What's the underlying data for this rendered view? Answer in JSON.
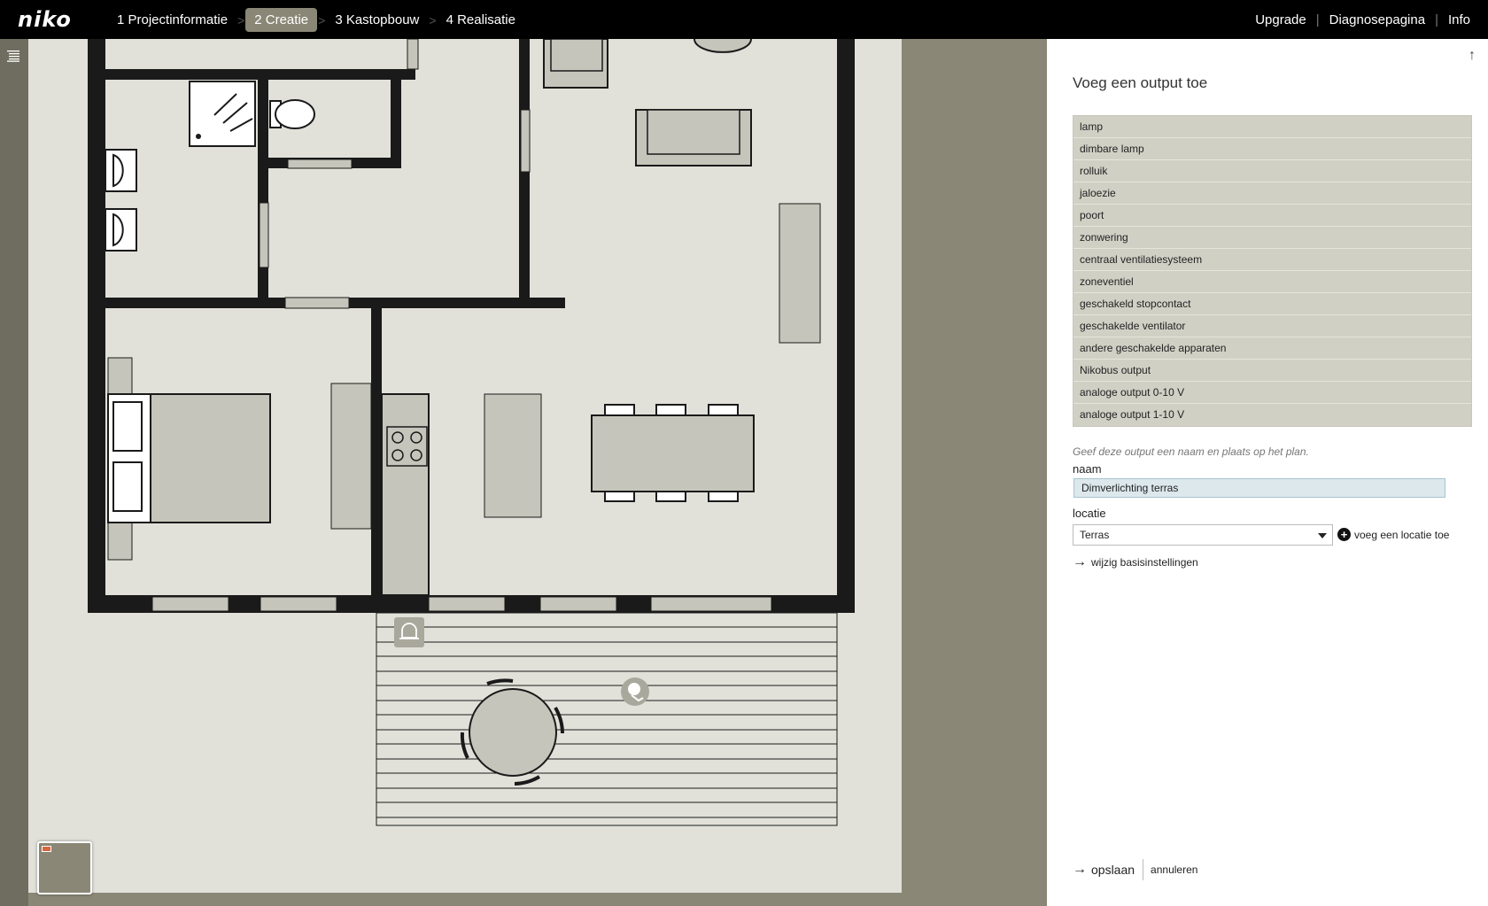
{
  "app": {
    "logo": "niko"
  },
  "steps": [
    {
      "label": "1 Projectinformatie",
      "active": false
    },
    {
      "label": "2 Creatie",
      "active": true
    },
    {
      "label": "3 Kastopbouw",
      "active": false
    },
    {
      "label": "4 Realisatie",
      "active": false
    }
  ],
  "header_links": {
    "upgrade": "Upgrade",
    "diagnose": "Diagnosepagina",
    "info": "Info"
  },
  "panel": {
    "title": "Voeg een output toe",
    "output_types": [
      "lamp",
      "dimbare lamp",
      "rolluik",
      "jaloezie",
      "poort",
      "zonwering",
      "centraal ventilatiesysteem",
      "zoneventiel",
      "geschakeld stopcontact",
      "geschakelde ventilator",
      "andere geschakelde apparaten",
      "Nikobus output",
      "analoge output 0-10 V",
      "analoge output 1-10 V"
    ],
    "hint": "Geef deze output een naam en plaats op het plan.",
    "name_label": "naam",
    "name_value": "Dimverlichting terras",
    "location_label": "locatie",
    "location_value": "Terras",
    "add_location": "voeg een locatie toe",
    "basic_settings": "wijzig basisinstellingen",
    "save": "opslaan",
    "cancel": "annuleren"
  },
  "colors": {
    "topbar": "#000000",
    "accent_step": "#8a8776",
    "plan_background": "#8a8776",
    "floor": "#e1e1da",
    "wall": "#1a1a1a",
    "furniture": "#c5c5bb",
    "list_item": "#d1d0c5",
    "name_field": "#dce8ec"
  }
}
